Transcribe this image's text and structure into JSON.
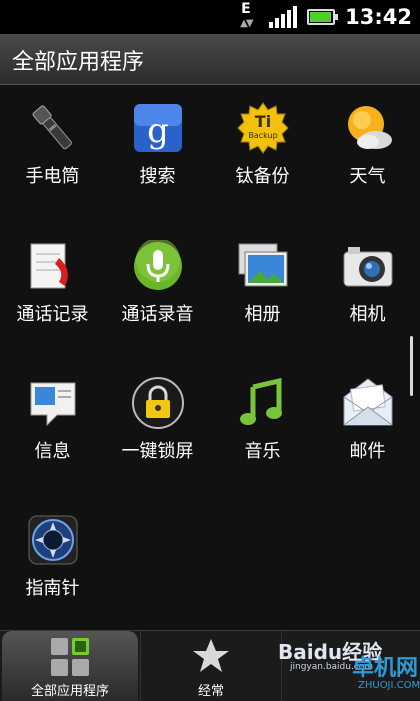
{
  "status_bar": {
    "network_type": "E",
    "time": "13:42",
    "battery_level": 0.95
  },
  "header": {
    "title": "全部应用程序"
  },
  "apps": [
    {
      "label": "手电筒",
      "icon": "flashlight-icon"
    },
    {
      "label": "搜索",
      "icon": "google-search-icon"
    },
    {
      "label": "钛备份",
      "icon": "titanium-backup-icon"
    },
    {
      "label": "天气",
      "icon": "weather-icon"
    },
    {
      "label": "通话记录",
      "icon": "call-log-icon"
    },
    {
      "label": "通话录音",
      "icon": "call-recorder-icon"
    },
    {
      "label": "相册",
      "icon": "gallery-icon"
    },
    {
      "label": "相机",
      "icon": "camera-icon"
    },
    {
      "label": "信息",
      "icon": "messages-icon"
    },
    {
      "label": "一键锁屏",
      "icon": "lock-screen-icon"
    },
    {
      "label": "音乐",
      "icon": "music-icon"
    },
    {
      "label": "邮件",
      "icon": "mail-icon"
    },
    {
      "label": "指南针",
      "icon": "compass-icon"
    }
  ],
  "titanium_icon_text": "Ti Backup",
  "bottom_tabs": [
    {
      "label": "全部应用程序",
      "icon": "all-apps-grid-icon",
      "active": true
    },
    {
      "label": "经常",
      "icon": "star-icon",
      "active": false
    }
  ],
  "watermarks": {
    "baidu": "Baidu经验",
    "baidu_url": "jingyan.baidu.com",
    "zhuoji": "卓机网",
    "zhuoji_url": "ZHUOJI.COM"
  },
  "colors": {
    "background": "#111111",
    "battery_green": "#4fce2a",
    "google_blue": "#2a62c9",
    "mic_green": "#6bb52b"
  }
}
